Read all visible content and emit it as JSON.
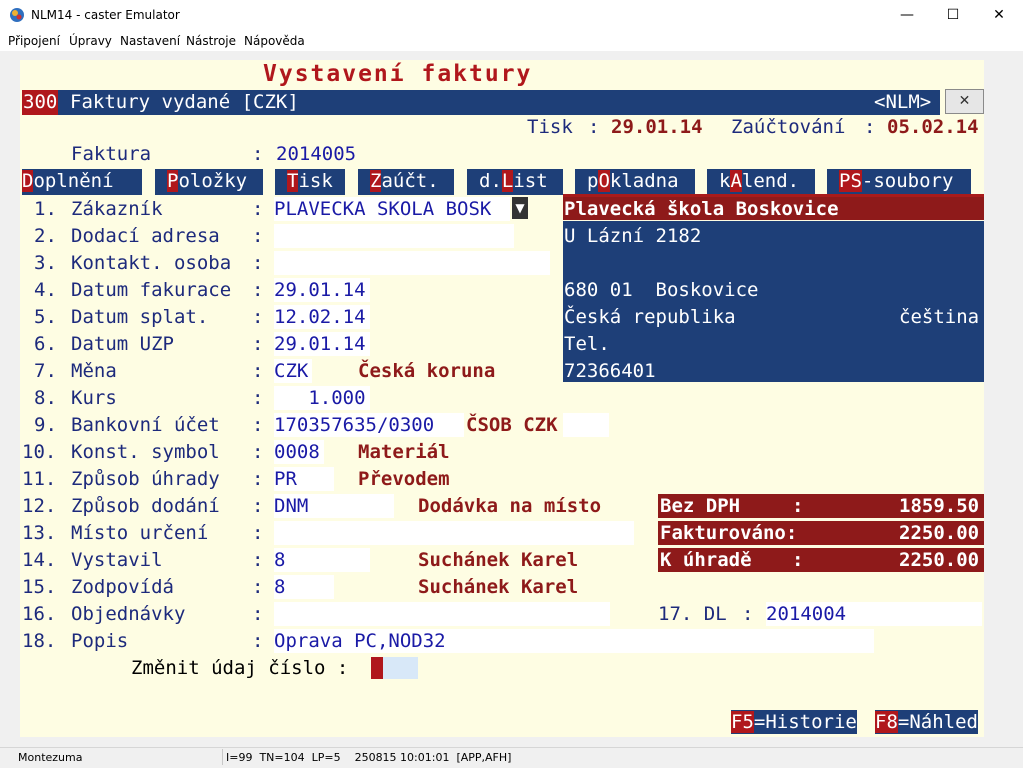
{
  "window": {
    "title": "NLM14 - caster Emulator",
    "minimize": "—",
    "maximize": "☐",
    "close": "✕"
  },
  "menu": [
    "Připojení",
    "Úpravy",
    "Nastavení",
    "Nástroje",
    "Nápověda"
  ],
  "screen": {
    "header_title": "Vystavení faktury",
    "module_code": "300",
    "module_name": "Faktury vydané [CZK]",
    "nlm_tag": "<NLM>",
    "close_x": "✕",
    "tisk_label": "Tisk",
    "tisk_date": "29.01.14",
    "zauct_label": "Zaúčtování",
    "zauct_date": "05.02.14",
    "colon": ":",
    "faktura_label": "Faktura",
    "faktura_value": "2014005",
    "tabs": [
      {
        "hk": "D",
        "rest": "oplnění"
      },
      {
        "hk": "P",
        "rest": "oložky"
      },
      {
        "hk": "T",
        "rest": "isk"
      },
      {
        "hk": "Z",
        "rest": "aúčt."
      },
      {
        "pre": "d.",
        "hk": "L",
        "rest": "ist"
      },
      {
        "pre": "p",
        "hk": "O",
        "rest": "kladna"
      },
      {
        "pre": "k",
        "hk": "A",
        "rest": "lend."
      },
      {
        "hk": "PS",
        "rest": "-soubory"
      }
    ],
    "fields": [
      {
        "num": "1.",
        "label": "Zákazník",
        "value": "PLAVECKA SKOLA BOSK",
        "extra": ""
      },
      {
        "num": "2.",
        "label": "Dodací adresa",
        "value": "",
        "extra": ""
      },
      {
        "num": "3.",
        "label": "Kontakt. osoba",
        "value": "",
        "extra": ""
      },
      {
        "num": "4.",
        "label": "Datum fakurace",
        "value": "29.01.14",
        "extra": ""
      },
      {
        "num": "5.",
        "label": "Datum splat.",
        "value": "12.02.14",
        "extra": ""
      },
      {
        "num": "6.",
        "label": "Datum UZP",
        "value": "29.01.14",
        "extra": ""
      },
      {
        "num": "7.",
        "label": "Měna",
        "value": "CZK",
        "extra": "Česká koruna"
      },
      {
        "num": "8.",
        "label": "Kurs",
        "value": "   1.000",
        "extra": ""
      },
      {
        "num": "9.",
        "label": "Bankovní účet",
        "value": "170357635/0300",
        "extra": "ČSOB CZK"
      },
      {
        "num": "10.",
        "label": "Konst. symbol",
        "value": "0008",
        "extra": "Materiál"
      },
      {
        "num": "11.",
        "label": "Způsob úhrady",
        "value": "PR",
        "extra": "Převodem"
      },
      {
        "num": "12.",
        "label": "Způsob dodání",
        "value": "DNM",
        "extra": "Dodávka na místo"
      },
      {
        "num": "13.",
        "label": "Místo určení",
        "value": "",
        "extra": ""
      },
      {
        "num": "14.",
        "label": "Vystavil",
        "value": "8",
        "extra": "Suchánek Karel"
      },
      {
        "num": "15.",
        "label": "Zodpovídá",
        "value": "8",
        "extra": "Suchánek Karel"
      },
      {
        "num": "16.",
        "label": "Objednávky",
        "value": "",
        "extra": ""
      },
      {
        "num": "18.",
        "label": "Popis",
        "value": "Oprava PC,NOD32",
        "extra": ""
      }
    ],
    "dropdown_arrow": "▼",
    "dl": {
      "label": "17. DL",
      "value": "2014004"
    },
    "customer": {
      "name": "Plavecká škola Boskovice",
      "street": "U Lázní 2182",
      "line3": "",
      "city": "680 01  Boskovice",
      "country": "Česká republika",
      "language": "čeština",
      "tel": "Tel.",
      "ico": "72366401"
    },
    "summary": [
      {
        "label": "Bez DPH",
        "sep": ":",
        "value": "1859.50"
      },
      {
        "label": "Fakturováno:",
        "sep": "",
        "value": "2250.00"
      },
      {
        "label": "K úhradě",
        "sep": ":",
        "value": "2250.00"
      }
    ],
    "change_prompt": "Změnit údaj číslo :",
    "f5": {
      "key": "F5",
      "label": "=Historie"
    },
    "f8": {
      "key": "F8",
      "label": "=Náhled"
    }
  },
  "status": {
    "company": "Montezuma",
    "info": "I=99  TN=104  LP=5    250815 10:01:01  [APP,AFH]"
  },
  "colors": {
    "navy": "#1e3f78",
    "dark_red": "#8e1a1a",
    "hotkey_red": "#b0171c",
    "terminal_bg": "#fefde3",
    "label_blue": "#1d2a7c"
  }
}
